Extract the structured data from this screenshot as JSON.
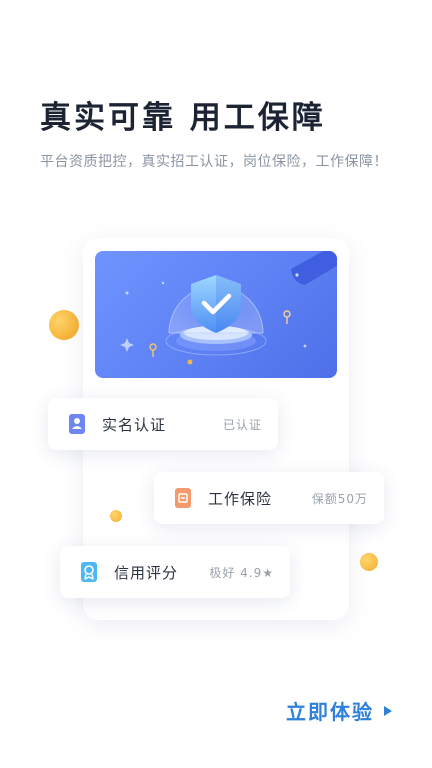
{
  "hero": {
    "title": "真实可靠 用工保障",
    "subtitle": "平台资质把控，真实招工认证，岗位保险，工作保障！"
  },
  "features": [
    {
      "icon": "id-card-icon",
      "label": "实名认证",
      "value": "已认证"
    },
    {
      "icon": "insurance-doc-icon",
      "label": "工作保险",
      "value": "保额50万"
    },
    {
      "icon": "credit-badge-icon",
      "label": "信用评分",
      "value": "极好 4.9★"
    }
  ],
  "cta": {
    "label": "立即体验"
  },
  "colors": {
    "accent": "#2f80d8",
    "banner": "#5c7ff3",
    "id_card": "#6d86f2",
    "insurance": "#f59a6c",
    "credit": "#4fb8f2"
  }
}
